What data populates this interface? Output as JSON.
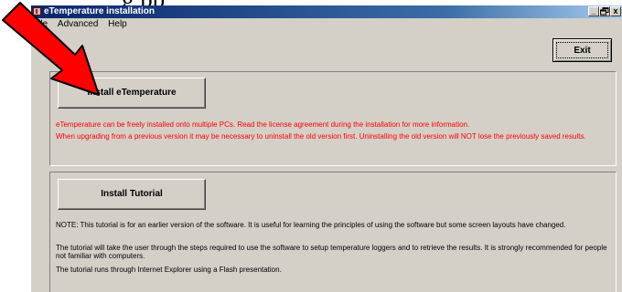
{
  "background_text": "g    pp",
  "window": {
    "title": "eTemperature installation",
    "buttons": {
      "minimize": "_",
      "restore": "Й",
      "close": "x"
    }
  },
  "menu": [
    "File",
    "Advanced",
    "Help"
  ],
  "exit_label": "Exit",
  "install": {
    "button_label": "Install eTemperature",
    "info_line1": "eTemperature can be freely installed onto multiple PCs. Read the license agreement during the installation for more information.",
    "info_line2": "When upgrading from a previous version it may be necessary to uninstall the old version first. Uninstalling the old version will NOT lose the previously saved results."
  },
  "tutorial": {
    "button_label": "Install Tutorial",
    "note1": "NOTE: This tutorial is for an earlier version of the software. It is useful for learning the principles of using the software but some screen layouts have changed.",
    "note2": "The tutorial will take the user through the steps required to use the software to  setup temperature loggers and to retrieve the results. It is strongly recommended for people not familiar with computers.",
    "note3": "The tutorial runs through Internet Explorer using a Flash presentation."
  },
  "colors": {
    "title_start": "#0a246a",
    "face": "#d4d0c8",
    "warning": "#ff0000",
    "arrow": "#ff0000"
  }
}
